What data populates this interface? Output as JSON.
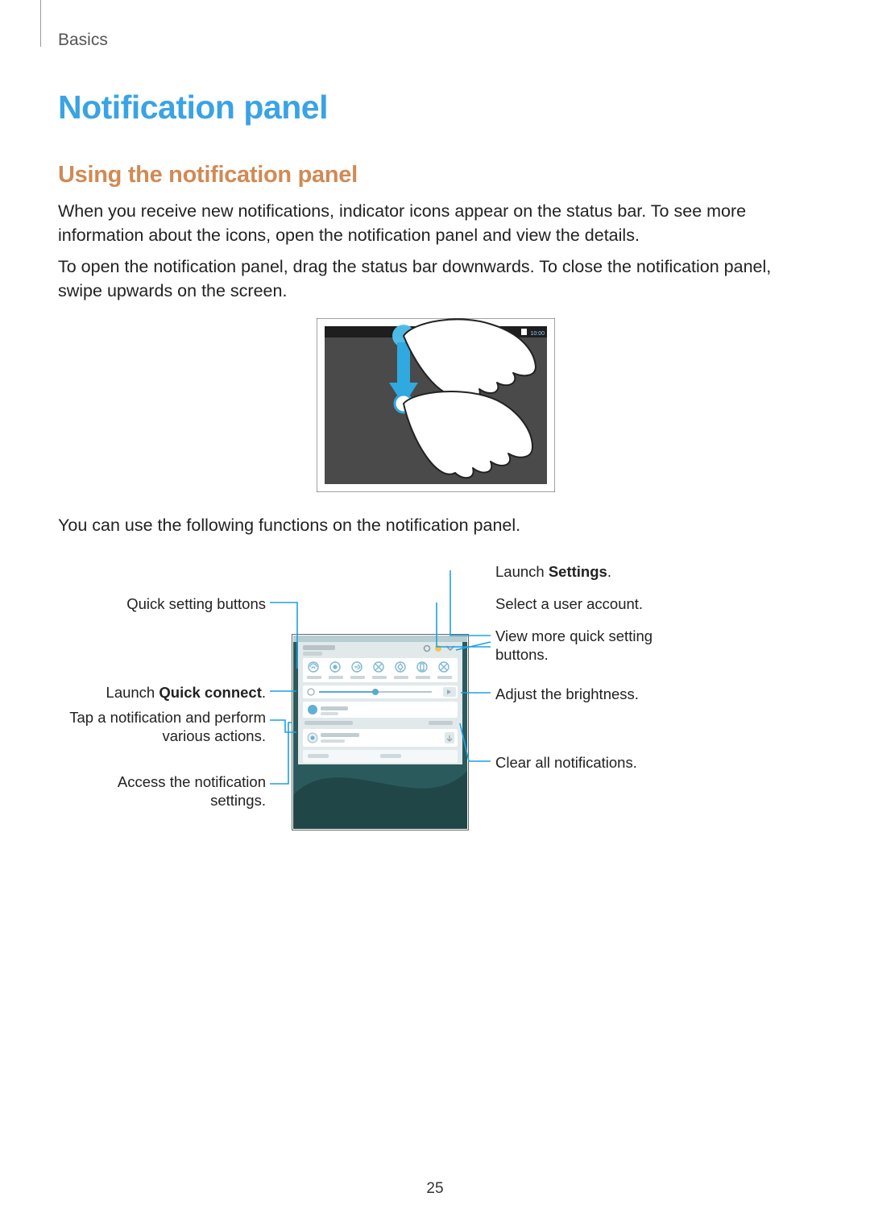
{
  "chapter": "Basics",
  "title": "Notification panel",
  "subtitle": "Using the notification panel",
  "para1": "When you receive new notifications, indicator icons appear on the status bar. To see more information about the icons, open the notification panel and view the details.",
  "para2": "To open the notification panel, drag the status bar downwards. To close the notification panel, swipe upwards on the screen.",
  "para3": "You can use the following functions on the notification panel.",
  "fig1": {
    "status_time": "10:00"
  },
  "callouts": {
    "left": {
      "quick_setting_buttons": "Quick setting buttons",
      "launch_quick_connect_pre": "Launch ",
      "launch_quick_connect_bold": "Quick connect",
      "launch_quick_connect_post": ".",
      "tap_notification": "Tap a notification and perform various actions.",
      "access_settings": "Access the notification settings."
    },
    "right": {
      "launch_settings_pre": "Launch ",
      "launch_settings_bold": "Settings",
      "launch_settings_post": ".",
      "select_user": "Select a user account.",
      "view_more": "View more quick setting buttons.",
      "adjust_brightness": "Adjust the brightness.",
      "clear_all": "Clear all notifications."
    }
  },
  "page_number": "25"
}
